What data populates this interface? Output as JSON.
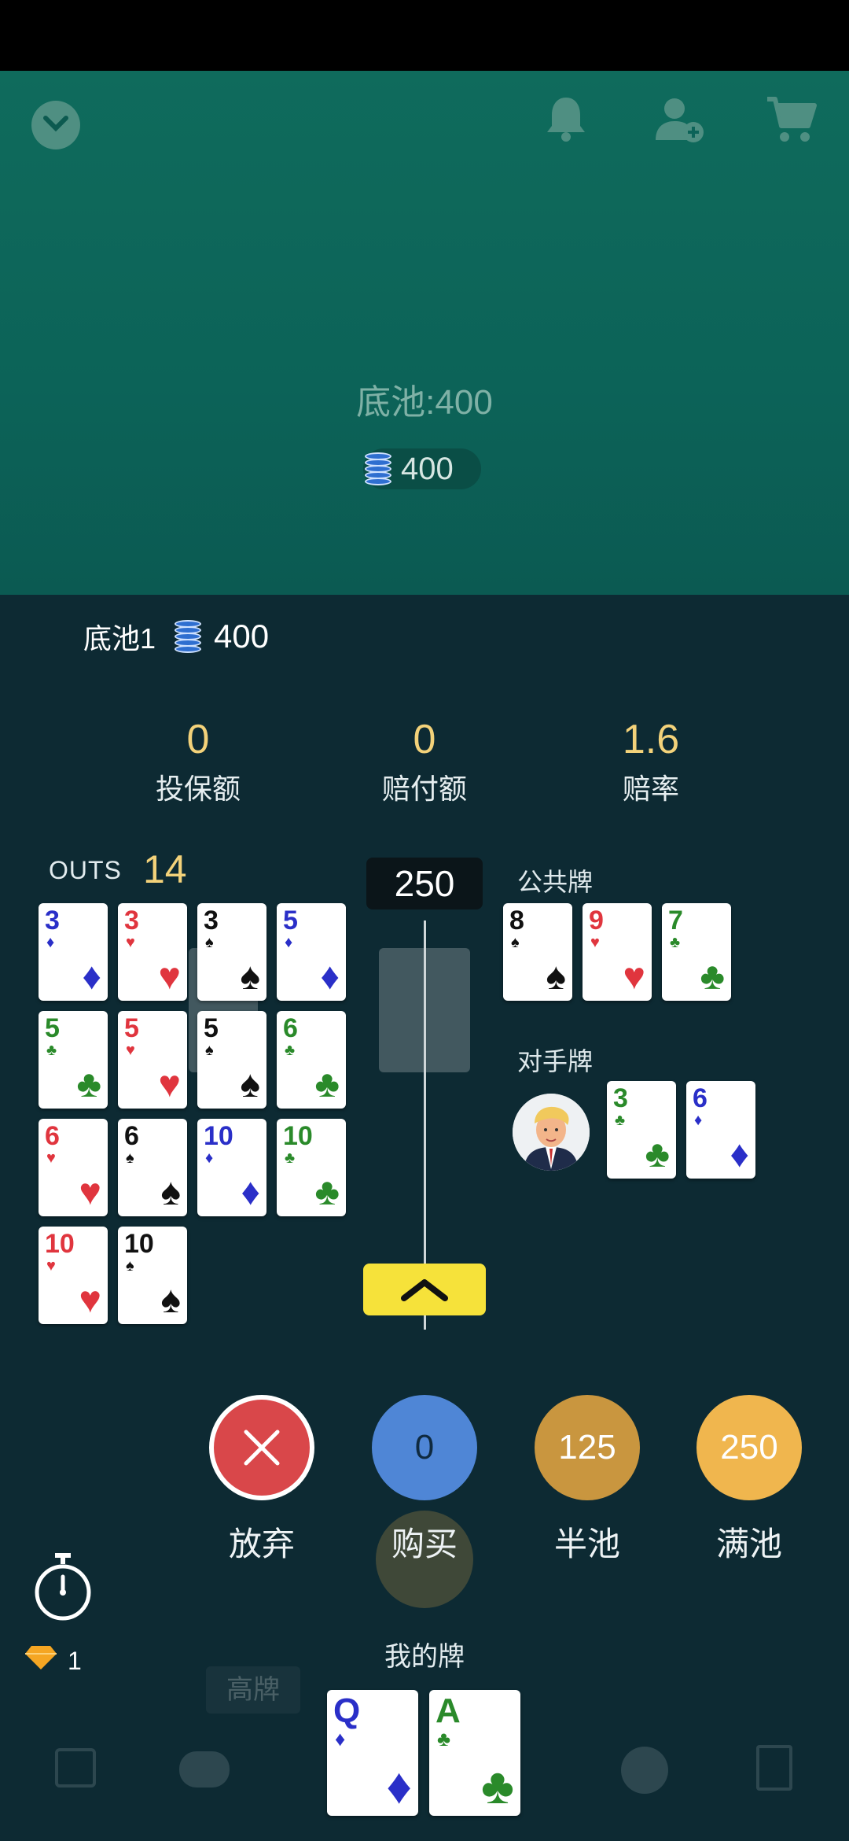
{
  "table": {
    "pot_title": "底池:400",
    "pot_amount": "400"
  },
  "side_pot": {
    "label": "底池1",
    "amount": "400"
  },
  "stats": [
    {
      "value": "0",
      "label": "投保额"
    },
    {
      "value": "0",
      "label": "赔付额"
    },
    {
      "value": "1.6",
      "label": "赔率"
    }
  ],
  "outs": {
    "label": "OUTS",
    "count": "14",
    "cards": [
      {
        "rank": "3",
        "suit": "♦",
        "color": "#2a2fc8"
      },
      {
        "rank": "3",
        "suit": "♥",
        "color": "#e0353e"
      },
      {
        "rank": "3",
        "suit": "♠",
        "color": "#111111"
      },
      {
        "rank": "5",
        "suit": "♦",
        "color": "#2a2fc8"
      },
      {
        "rank": "5",
        "suit": "♣",
        "color": "#2a8a2a"
      },
      {
        "rank": "5",
        "suit": "♥",
        "color": "#e0353e"
      },
      {
        "rank": "5",
        "suit": "♠",
        "color": "#111111"
      },
      {
        "rank": "6",
        "suit": "♣",
        "color": "#2a8a2a"
      },
      {
        "rank": "6",
        "suit": "♥",
        "color": "#e0353e"
      },
      {
        "rank": "6",
        "suit": "♠",
        "color": "#111111"
      },
      {
        "rank": "10",
        "suit": "♦",
        "color": "#2a2fc8"
      },
      {
        "rank": "10",
        "suit": "♣",
        "color": "#2a8a2a"
      },
      {
        "rank": "10",
        "suit": "♥",
        "color": "#e0353e"
      },
      {
        "rank": "10",
        "suit": "♠",
        "color": "#111111"
      }
    ]
  },
  "slider": {
    "value": "250"
  },
  "community": {
    "label": "公共牌",
    "cards": [
      {
        "rank": "8",
        "suit": "♠",
        "color": "#111111"
      },
      {
        "rank": "9",
        "suit": "♥",
        "color": "#e0353e"
      },
      {
        "rank": "7",
        "suit": "♣",
        "color": "#2a8a2a"
      }
    ]
  },
  "opponent": {
    "label": "对手牌",
    "cards": [
      {
        "rank": "3",
        "suit": "♣",
        "color": "#2a8a2a"
      },
      {
        "rank": "6",
        "suit": "♦",
        "color": "#2a2fc8"
      }
    ]
  },
  "actions": [
    {
      "label": "放弃",
      "value": ""
    },
    {
      "label": "购买",
      "value": "0"
    },
    {
      "label": "半池",
      "value": "125"
    },
    {
      "label": "满池",
      "value": "250"
    }
  ],
  "gems": {
    "count": "1"
  },
  "my_cards": {
    "label": "我的牌",
    "cards": [
      {
        "rank": "Q",
        "suit": "♦",
        "color": "#2a2fc8"
      },
      {
        "rank": "A",
        "suit": "♣",
        "color": "#2a8a2a"
      }
    ]
  },
  "icons": {
    "top": [
      "chevron-down-icon",
      "bell-icon",
      "add-user-icon",
      "cart-icon"
    ],
    "bottom": [
      "calendar-icon",
      "chat-icon",
      "emoji-icon",
      "cards-icon"
    ]
  },
  "colors": {
    "table_green": "#0c6358",
    "panel_bg": "#0d2a33",
    "gold": "#f3d27a",
    "fold_red": "#d9474a",
    "buy_blue": "#4f86d6",
    "half_orange": "#c9963f",
    "full_orange": "#f0b64e",
    "slider_yellow": "#f6e23a"
  },
  "background": {
    "faded_labels": [
      "高牌"
    ]
  }
}
